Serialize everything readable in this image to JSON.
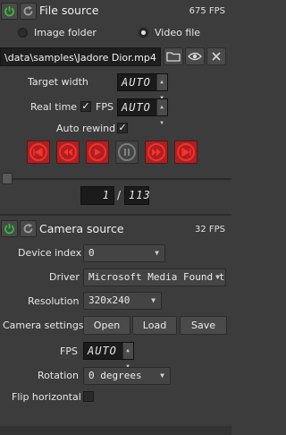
{
  "file_source": {
    "title": "File source",
    "fps": "675 FPS",
    "mode_image_label": "Image folder",
    "mode_video_label": "Video file",
    "selected_mode": "video",
    "path": "\\data\\samples\\Jadore Dior.mp4",
    "target_width_label": "Target width",
    "target_width_value": "AUTO",
    "real_time_label": "Real time",
    "fps_label": "FPS",
    "fps_value": "AUTO",
    "auto_rewind_label": "Auto rewind",
    "frame_current": "1",
    "frame_separator": "/",
    "frame_total": "113"
  },
  "camera_source": {
    "title": "Camera source",
    "fps": "32 FPS",
    "device_index_label": "Device index",
    "device_index_value": "0",
    "driver_label": "Driver",
    "driver_value": "Microsoft Media Foundation",
    "resolution_label": "Resolution",
    "resolution_value": "320x240",
    "camera_settings_label": "Camera settings",
    "open_label": "Open",
    "load_label": "Load",
    "save_label": "Save",
    "fps_label": "FPS",
    "fps_value": "AUTO",
    "rotation_label": "Rotation",
    "rotation_value": "0 degrees",
    "flip_label": "Flip horizontal"
  },
  "colors": {
    "power_green": "#2fbf3a",
    "media_red": "#ff2b2b",
    "panel_bg": "#3c3c3c"
  }
}
